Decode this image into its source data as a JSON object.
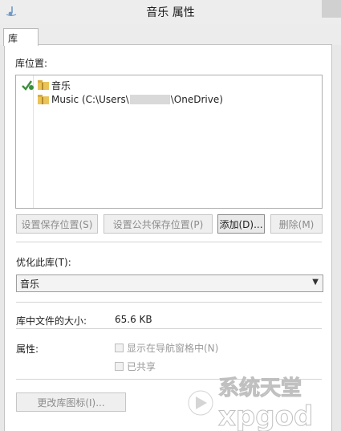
{
  "window": {
    "title": "音乐 属性"
  },
  "tabs": [
    {
      "label": "库"
    }
  ],
  "locations": {
    "label": "库位置:",
    "items": [
      {
        "text": "音乐",
        "is_default": true
      },
      {
        "text_before": "Music (C:\\Users\\",
        "text_after": "\\OneDrive)",
        "is_default": false
      }
    ]
  },
  "buttons": {
    "set_save": "设置保存位置(S)",
    "set_public_save": "设置公共保存位置(P)",
    "add": "添加(D)...",
    "remove": "删除(M)",
    "change_icon": "更改库图标(I)..."
  },
  "optimize": {
    "label": "优化此库(T):",
    "selected": "音乐"
  },
  "size": {
    "label": "库中文件的大小:",
    "value": "65.6 KB"
  },
  "attributes": {
    "label": "属性:",
    "show_in_nav": {
      "label": "显示在导航窗格中(N)",
      "checked": false
    },
    "shared": {
      "label": "已共享",
      "checked": false
    }
  },
  "watermark": {
    "text": "系统天堂",
    "domain": "xpgod"
  },
  "colors": {
    "accent_green": "#3c8f3c",
    "folder_yellow": "#e8c45a",
    "disabled_text": "#8c8c8c"
  }
}
